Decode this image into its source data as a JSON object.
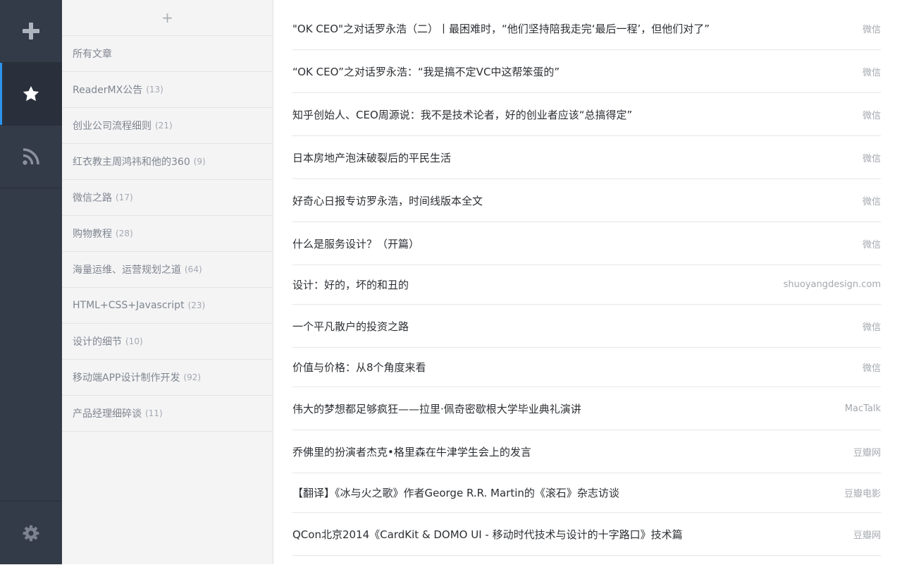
{
  "rail": {
    "icons": [
      "plus-icon",
      "star-icon",
      "rss-icon",
      "gear-icon"
    ],
    "active": "star",
    "accent_color": "#2b95f0"
  },
  "sidebar": {
    "add_label": "+",
    "items": [
      {
        "label": "所有文章",
        "count": ""
      },
      {
        "label": "ReaderMX公告",
        "count": "(13)"
      },
      {
        "label": "创业公司流程细则",
        "count": "(21)"
      },
      {
        "label": "红衣教主周鸿祎和他的360",
        "count": "(9)"
      },
      {
        "label": "微信之路",
        "count": "(17)"
      },
      {
        "label": "购物教程",
        "count": "(28)"
      },
      {
        "label": "海量运维、运营规划之道",
        "count": "(64)"
      },
      {
        "label": "HTML+CSS+Javascript",
        "count": "(23)"
      },
      {
        "label": "设计的细节",
        "count": "(10)"
      },
      {
        "label": "移动端APP设计制作开发",
        "count": "(92)"
      },
      {
        "label": "产品经理细碎谈",
        "count": "(11)"
      }
    ]
  },
  "articles": [
    {
      "title": "\"OK CEO\"之对话罗永浩（二）丨最困难时，“他们坚持陪我走完‘最后一程’，但他们对了”",
      "source": "微信"
    },
    {
      "title": "“OK CEO”之对话罗永浩：“我是搞不定VC中这帮笨蛋的”",
      "source": "微信"
    },
    {
      "title": "知乎创始人、CEO周源说：我不是技术论者，好的创业者应该“总搞得定”",
      "source": "微信"
    },
    {
      "title": "日本房地产泡沫破裂后的平民生活",
      "source": "微信"
    },
    {
      "title": "好奇心日报专访罗永浩，时间线版本全文",
      "source": "微信"
    },
    {
      "title": "什么是服务设计？（开篇）",
      "source": "微信"
    },
    {
      "title": "设计：好的，坏的和丑的",
      "source": "shuoyangdesign.com"
    },
    {
      "title": "一个平凡散户的投资之路",
      "source": "微信"
    },
    {
      "title": "价值与价格：从8个角度来看",
      "source": "微信"
    },
    {
      "title": "伟大的梦想都足够疯狂——拉里·佩奇密歇根大学毕业典礼演讲",
      "source": "MacTalk"
    },
    {
      "title": "乔佛里的扮演者杰克•格里森在牛津学生会上的发言",
      "source": "豆瓣网"
    },
    {
      "title": "【翻译】《冰与火之歌》作者George R.R. Martin的《滚石》杂志访谈",
      "source": "豆瓣电影"
    },
    {
      "title": "QCon北京2014《CardKit & DOMO UI - 移动时代技术与设计的十字路口》技术篇",
      "source": "豆瓣网"
    }
  ]
}
